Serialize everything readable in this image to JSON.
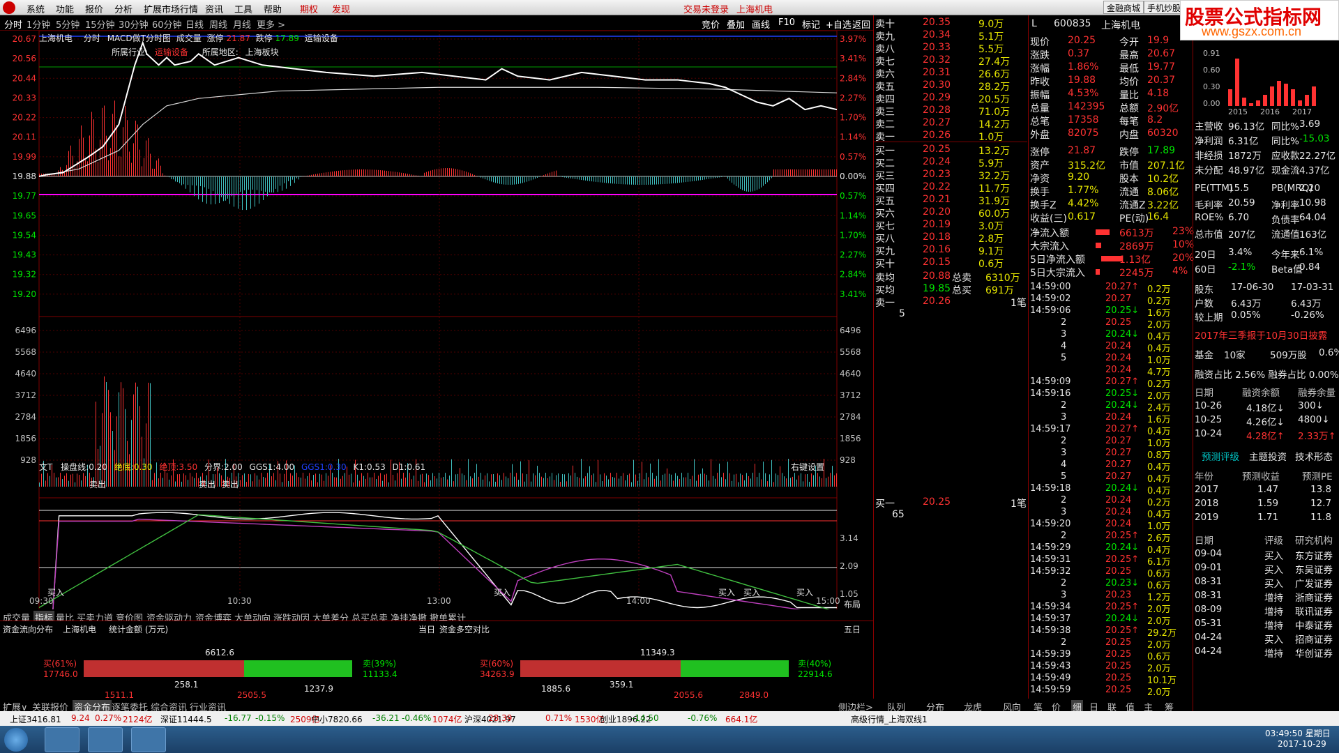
{
  "menu": {
    "items": [
      "系统",
      "功能",
      "报价",
      "分析",
      "扩展市场行情",
      "资讯",
      "工具",
      "帮助"
    ],
    "options_label": "期权",
    "discover_label": "发现",
    "trade_status": "交易未登录",
    "stock_title": "上海机电",
    "mall_button": "金融商城",
    "mobile_button": "手机炒股"
  },
  "brand": {
    "title": "股票公式指标网",
    "url": "www.gszx.com.cn"
  },
  "periods": [
    "分时",
    "1分钟",
    "5分钟",
    "15分钟",
    "30分钟",
    "60分钟",
    "日线",
    "周线",
    "月线",
    "更多 >"
  ],
  "tools": [
    "竞价",
    "叠加",
    "画线",
    "F10",
    "标记",
    "+自选",
    "返回"
  ],
  "chart": {
    "header": {
      "name": "上海机电",
      "type": "分时",
      "indicator": "MACD做T分时图",
      "vol_label": "成交量",
      "limit_up_label": "涨停",
      "limit_up": "21.87",
      "limit_down_label": "跌停",
      "limit_down": "17.89",
      "industry": "运输设备"
    },
    "sector": {
      "industry_label": "所属行业:",
      "industry": "运输设备",
      "region_label": "所属地区:",
      "region": "上海板块"
    },
    "price_ticks": [
      "20.67",
      "20.56",
      "20.44",
      "20.33",
      "20.22",
      "20.11",
      "19.99",
      "19.88",
      "19.77",
      "19.65",
      "19.54",
      "19.43",
      "19.32",
      "19.20"
    ],
    "pct_ticks": [
      "3.97%",
      "3.41%",
      "2.84%",
      "2.27%",
      "1.70%",
      "1.14%",
      "0.57%",
      "0.00%",
      "0.57%",
      "1.14%",
      "1.70%",
      "2.27%",
      "2.84%",
      "3.41%"
    ],
    "vol_ticks": [
      "6496",
      "5568",
      "4640",
      "3712",
      "2784",
      "1856",
      "928"
    ],
    "time_ticks": [
      "09:30",
      "10:30",
      "13:00",
      "14:00",
      "15:00"
    ],
    "layout_label": "布局",
    "indicator_header": {
      "name": "文T",
      "line1_label": "操盘线:",
      "line1": "0.20",
      "line2_label": "绝底:",
      "line2": "0.30",
      "line3_label": "绝顶:",
      "line3": "3.50",
      "line4_label": "分界:",
      "line4": "2.00",
      "line5_label": "GGS1:",
      "line5": "4.00",
      "line6_label": "GGS1:",
      "line6": "0.30",
      "k_label": "K1:",
      "k": "0.53",
      "d_label": "D1:",
      "d": "0.61",
      "settings": "右键设置"
    },
    "ind_ticks": [
      "3.14",
      "2.09",
      "1.05"
    ],
    "signal_sell": "卖出",
    "signal_buy": "买入"
  },
  "bottom_tabs": [
    "成交量",
    "指标",
    "量比",
    "买卖力道",
    "竞价图",
    "资金驱动力",
    "资金博弈",
    "大单动向",
    "涨跌动因",
    "大单差分",
    "总买总卖",
    "净挂净撤",
    "撤单累计"
  ],
  "flow": {
    "title": "资金流向分布",
    "stock": "上海机电",
    "unit": "统计金额 (万元)",
    "today": "当日",
    "compare": "资金多空对比",
    "five_day": "五日",
    "left": {
      "total": "6612.6",
      "buy_label": "买(61%)",
      "buy": "17746.0",
      "sell_label": "卖(39%)",
      "sell": "11133.4",
      "a": "258.1",
      "b": "1237.9",
      "c": "1511.1",
      "d": "2505.5"
    },
    "right": {
      "total": "11349.3",
      "buy_label": "买(60%)",
      "buy": "34263.9",
      "sell_label": "卖(40%)",
      "sell": "22914.6",
      "a": "359.1",
      "b": "1885.6",
      "c": "2055.6",
      "d": "2849.0"
    }
  },
  "flow_tabs": [
    "扩展∨",
    "关联报价",
    "资金分布",
    "逐笔委托",
    "综合资讯",
    "行业资讯"
  ],
  "mid_tabs": [
    "侧边栏>",
    "队列",
    "分布",
    "龙虎",
    "风向"
  ],
  "right_tabs": [
    "笔",
    "价",
    "细",
    "日",
    "联",
    "值",
    "主",
    "筹"
  ],
  "orderbook": {
    "asks": [
      [
        "卖十",
        "20.35",
        "9.0万"
      ],
      [
        "卖九",
        "20.34",
        "5.1万"
      ],
      [
        "卖八",
        "20.33",
        "5.5万"
      ],
      [
        "卖七",
        "20.32",
        "27.4万"
      ],
      [
        "卖六",
        "20.31",
        "26.6万"
      ],
      [
        "卖五",
        "20.30",
        "28.2万"
      ],
      [
        "卖四",
        "20.29",
        "20.5万"
      ],
      [
        "卖三",
        "20.28",
        "71.0万"
      ],
      [
        "卖二",
        "20.27",
        "14.2万"
      ],
      [
        "卖一",
        "20.26",
        "1.0万"
      ]
    ],
    "bids": [
      [
        "买一",
        "20.25",
        "13.2万"
      ],
      [
        "买二",
        "20.24",
        "5.9万"
      ],
      [
        "买三",
        "20.23",
        "32.2万"
      ],
      [
        "买四",
        "20.22",
        "11.7万"
      ],
      [
        "买五",
        "20.21",
        "31.9万"
      ],
      [
        "买六",
        "20.20",
        "60.0万"
      ],
      [
        "买七",
        "20.19",
        "3.0万"
      ],
      [
        "买八",
        "20.18",
        "2.8万"
      ],
      [
        "买九",
        "20.16",
        "9.1万"
      ],
      [
        "买十",
        "20.15",
        "0.6万"
      ]
    ],
    "avg": [
      [
        "卖均",
        "20.88",
        "总卖",
        "6310万"
      ],
      [
        "买均",
        "19.85",
        "总买",
        "691万"
      ]
    ],
    "sell1": {
      "label": "卖一",
      "price": "20.26",
      "count": "1笔",
      "queue": "5"
    },
    "buy1": {
      "label": "买一",
      "price": "20.25",
      "count": "1笔",
      "queue": "65"
    }
  },
  "quote": {
    "code": "600835",
    "name": "上海机电",
    "rows": [
      [
        "现价",
        "20.25",
        "今开",
        "19.9"
      ],
      [
        "涨跌",
        "0.37",
        "最高",
        "20.67"
      ],
      [
        "涨幅",
        "1.86%",
        "最低",
        "19.77"
      ],
      [
        "昨收",
        "19.88",
        "均价",
        "20.37"
      ],
      [
        "振幅",
        "4.53%",
        "量比",
        "4.18"
      ],
      [
        "总量",
        "142395",
        "总额",
        "2.90亿"
      ],
      [
        "总笔",
        "17358",
        "每笔",
        "8.2"
      ],
      [
        "外盘",
        "82075",
        "内盘",
        "60320"
      ]
    ],
    "rows2": [
      [
        "涨停",
        "21.87",
        "跌停",
        "17.89"
      ],
      [
        "资产",
        "315.2亿",
        "市值",
        "207.1亿"
      ],
      [
        "净资",
        "9.20",
        "股本",
        "10.2亿"
      ],
      [
        "换手",
        "1.77%",
        "流通",
        "8.06亿"
      ],
      [
        "换手Z",
        "4.42%",
        "流通Z",
        "3.22亿"
      ],
      [
        "收益(三)",
        "0.617",
        "PE(动)",
        "16.4"
      ]
    ],
    "flows": [
      [
        "净流入额",
        "6613万",
        "23%"
      ],
      [
        "大宗流入",
        "2869万",
        "10%"
      ],
      [
        "5日净流入额",
        "1.13亿",
        "20%"
      ],
      [
        "5日大宗流入",
        "2245万",
        "4%"
      ]
    ]
  },
  "ticks": [
    [
      "14:59:00",
      "20.27↑",
      "0.2万"
    ],
    [
      "14:59:02",
      "20.27",
      "0.2万"
    ],
    [
      "14:59:06",
      "20.25↓",
      "1.6万"
    ],
    [
      "2",
      "20.25",
      "2.0万"
    ],
    [
      "3",
      "20.24↓",
      "0.4万"
    ],
    [
      "4",
      "20.24",
      "0.4万"
    ],
    [
      "5",
      "20.24",
      "1.0万"
    ],
    [
      "",
      "20.24",
      "4.7万"
    ],
    [
      "14:59:09",
      "20.27↑",
      "0.2万"
    ],
    [
      "14:59:16",
      "20.25↓",
      "2.0万"
    ],
    [
      "2",
      "20.24↓",
      "2.4万"
    ],
    [
      "3",
      "20.24",
      "1.6万"
    ],
    [
      "14:59:17",
      "20.27↑",
      "0.4万"
    ],
    [
      "2",
      "20.27",
      "1.0万"
    ],
    [
      "3",
      "20.27",
      "0.8万"
    ],
    [
      "4",
      "20.27",
      "0.4万"
    ],
    [
      "5",
      "20.27",
      "0.4万"
    ],
    [
      "14:59:18",
      "20.24↓",
      "0.4万"
    ],
    [
      "2",
      "20.24",
      "0.2万"
    ],
    [
      "3",
      "20.24",
      "0.4万"
    ],
    [
      "14:59:20",
      "20.24",
      "1.0万"
    ],
    [
      "2",
      "20.25↑",
      "2.6万"
    ],
    [
      "14:59:29",
      "20.24↓",
      "0.4万"
    ],
    [
      "14:59:31",
      "20.25↑",
      "6.1万"
    ],
    [
      "14:59:32",
      "20.25",
      "0.6万"
    ],
    [
      "2",
      "20.23↓",
      "0.6万"
    ],
    [
      "3",
      "20.23",
      "1.2万"
    ],
    [
      "14:59:34",
      "20.25↑",
      "2.0万"
    ],
    [
      "14:59:37",
      "20.24↓",
      "2.0万"
    ],
    [
      "14:59:38",
      "20.25↑",
      "29.2万"
    ],
    [
      "2",
      "20.25",
      "2.0万"
    ],
    [
      "14:59:39",
      "20.25",
      "0.6万"
    ],
    [
      "14:59:43",
      "20.25",
      "2.0万"
    ],
    [
      "14:59:49",
      "20.25",
      "10.1万"
    ],
    [
      "14:59:59",
      "20.25",
      "2.0万"
    ]
  ],
  "fundamentals": {
    "bar_years": [
      "2015",
      "2016",
      "2017"
    ],
    "bar_axis": [
      "0.91",
      "0.60",
      "0.30",
      "0.00"
    ],
    "bars": [
      0.3,
      0.85,
      0.15,
      0.05,
      0.1,
      0.2,
      0.35,
      0.45,
      0.4,
      0.3,
      0.1,
      0.2,
      0.35
    ],
    "rows": [
      [
        "主营收",
        "96.13亿",
        "同比%",
        "3.69"
      ],
      [
        "净利润",
        "6.31亿",
        "同比%",
        "-15.03"
      ],
      [
        "非经损",
        "1872万",
        "应收款",
        "22.27亿"
      ],
      [
        "未分配",
        "48.97亿",
        "现金流",
        "4.37亿"
      ],
      [
        "PE(TTM)",
        "15.5",
        "PB(MRQ)",
        "2.20"
      ],
      [
        "毛利率",
        "20.59",
        "净利率",
        "10.98"
      ],
      [
        "ROE%",
        "6.70",
        "负债率",
        "64.04"
      ],
      [
        "总市值",
        "207亿",
        "流通值",
        "163亿"
      ],
      [
        "20日",
        "3.4%",
        "今年来",
        "6.1%"
      ],
      [
        "60日",
        "-2.1%",
        "Beta值",
        "0.84"
      ]
    ],
    "holders": [
      [
        "股东",
        "17-06-30",
        "17-03-31"
      ],
      [
        "户数",
        "6.43万",
        "6.43万"
      ],
      [
        "较上期",
        "0.05%",
        "-0.26%"
      ]
    ],
    "report": "2017年三季报于10月30日披露",
    "fund_row": [
      "基金",
      "10家",
      "509万股",
      "0.6%"
    ],
    "margin_ratio": "融资占比 2.56% 融券占比 0.00%",
    "margin_head": [
      "日期",
      "融资余额",
      "融券余量"
    ],
    "margin": [
      [
        "10-26",
        "4.18亿↓",
        "300↓"
      ],
      [
        "10-25",
        "4.26亿↓",
        "4800↓"
      ],
      [
        "10-24",
        "4.28亿↑",
        "2.33万↑"
      ]
    ],
    "tabs": [
      "预测评级",
      "主题投资",
      "技术形态"
    ],
    "forecast_head": [
      "年份",
      "预测收益",
      "预测PE"
    ],
    "forecast": [
      [
        "2017",
        "1.47",
        "13.8"
      ],
      [
        "2018",
        "1.59",
        "12.7"
      ],
      [
        "2019",
        "1.71",
        "11.8"
      ]
    ],
    "rating_head": [
      "日期",
      "评级",
      "研究机构"
    ],
    "ratings": [
      [
        "09-04",
        "买入",
        "东方证券"
      ],
      [
        "09-01",
        "买入",
        "东吴证券"
      ],
      [
        "08-31",
        "买入",
        "广发证券"
      ],
      [
        "08-31",
        "增持",
        "浙商证券"
      ],
      [
        "08-09",
        "增持",
        "联讯证券"
      ],
      [
        "05-31",
        "增持",
        "中泰证券"
      ],
      [
        "04-24",
        "买入",
        "招商证券"
      ],
      [
        "04-24",
        "增持",
        "华创证券"
      ]
    ]
  },
  "statusbar": {
    "items": [
      "上证3416.81",
      "9.24",
      "0.27%",
      "2124亿",
      "深证11444.5",
      "-16.77",
      "-0.15%",
      "2509亿",
      "中小7820.66",
      "-36.21",
      "-0.46%",
      "1074亿",
      "沪深4021.97",
      "28.39",
      "0.71%",
      "1530亿",
      "创业1896.22",
      "-14.50",
      "-0.76%",
      "664.1亿"
    ],
    "feed": "高级行情_上海双线1"
  },
  "taskbar": {
    "time": "03:49:50 星期日",
    "date": "2017-10-29"
  },
  "colors": {
    "up": "#ff3232",
    "down": "#00e600",
    "grid": "#800000",
    "bg": "#000000"
  }
}
